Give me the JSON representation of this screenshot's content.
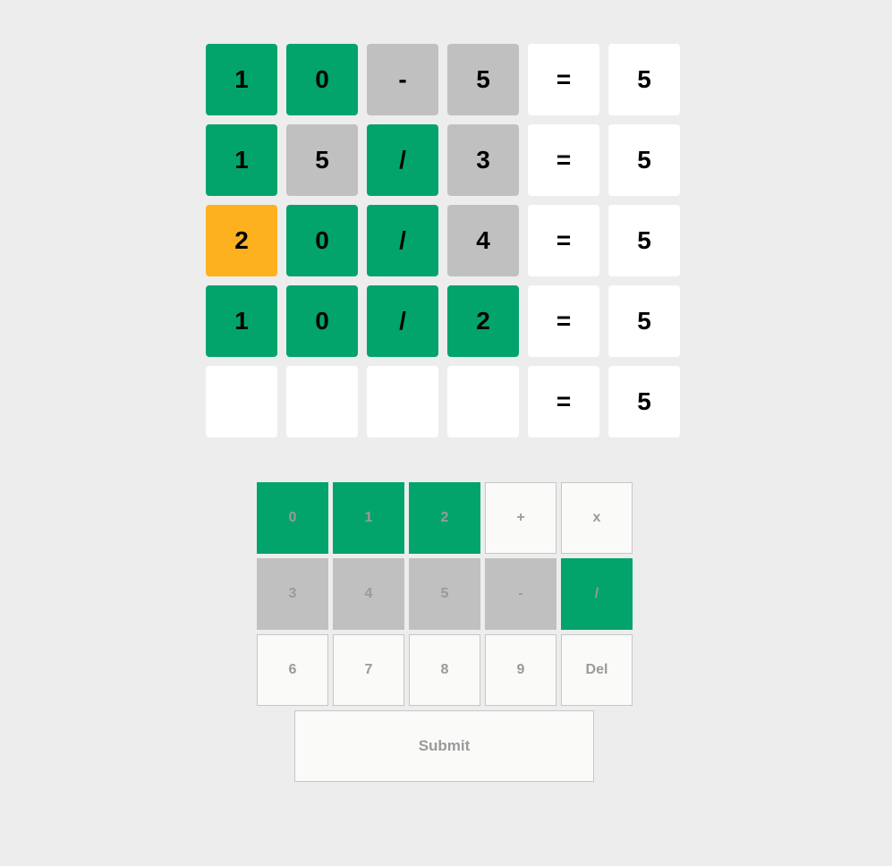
{
  "colors": {
    "background": "#ededed",
    "correct": "#02a46c",
    "present": "#fdb11e",
    "absent": "#c0c0c0",
    "empty": "#ffffff",
    "key_default": "#fafaf9",
    "key_text": "#9a9a9a"
  },
  "board": {
    "rows": [
      [
        {
          "value": "1",
          "state": "correct"
        },
        {
          "value": "0",
          "state": "correct"
        },
        {
          "value": "-",
          "state": "absent"
        },
        {
          "value": "5",
          "state": "absent"
        },
        {
          "value": "=",
          "state": "fixed"
        },
        {
          "value": "5",
          "state": "fixed"
        }
      ],
      [
        {
          "value": "1",
          "state": "correct"
        },
        {
          "value": "5",
          "state": "absent"
        },
        {
          "value": "/",
          "state": "correct"
        },
        {
          "value": "3",
          "state": "absent"
        },
        {
          "value": "=",
          "state": "fixed"
        },
        {
          "value": "5",
          "state": "fixed"
        }
      ],
      [
        {
          "value": "2",
          "state": "present"
        },
        {
          "value": "0",
          "state": "correct"
        },
        {
          "value": "/",
          "state": "correct"
        },
        {
          "value": "4",
          "state": "absent"
        },
        {
          "value": "=",
          "state": "fixed"
        },
        {
          "value": "5",
          "state": "fixed"
        }
      ],
      [
        {
          "value": "1",
          "state": "correct"
        },
        {
          "value": "0",
          "state": "correct"
        },
        {
          "value": "/",
          "state": "correct"
        },
        {
          "value": "2",
          "state": "correct"
        },
        {
          "value": "=",
          "state": "fixed"
        },
        {
          "value": "5",
          "state": "fixed"
        }
      ],
      [
        {
          "value": "",
          "state": "empty"
        },
        {
          "value": "",
          "state": "empty"
        },
        {
          "value": "",
          "state": "empty"
        },
        {
          "value": "",
          "state": "empty"
        },
        {
          "value": "=",
          "state": "fixed"
        },
        {
          "value": "5",
          "state": "fixed"
        }
      ]
    ]
  },
  "keyboard": {
    "keys": [
      {
        "label": "0",
        "state": "correct",
        "name": "key-0"
      },
      {
        "label": "1",
        "state": "correct",
        "name": "key-1"
      },
      {
        "label": "2",
        "state": "correct",
        "name": "key-2"
      },
      {
        "label": "+",
        "state": "unused",
        "name": "key-plus"
      },
      {
        "label": "x",
        "state": "unused",
        "name": "key-multiply"
      },
      {
        "label": "3",
        "state": "absent",
        "name": "key-3"
      },
      {
        "label": "4",
        "state": "absent",
        "name": "key-4"
      },
      {
        "label": "5",
        "state": "absent",
        "name": "key-5"
      },
      {
        "label": "-",
        "state": "absent",
        "name": "key-minus"
      },
      {
        "label": "/",
        "state": "correct",
        "name": "key-divide"
      },
      {
        "label": "6",
        "state": "unused",
        "name": "key-6"
      },
      {
        "label": "7",
        "state": "unused",
        "name": "key-7"
      },
      {
        "label": "8",
        "state": "unused",
        "name": "key-8"
      },
      {
        "label": "9",
        "state": "unused",
        "name": "key-9"
      },
      {
        "label": "Del",
        "state": "unused",
        "name": "delete-key"
      }
    ],
    "submit_label": "Submit"
  }
}
